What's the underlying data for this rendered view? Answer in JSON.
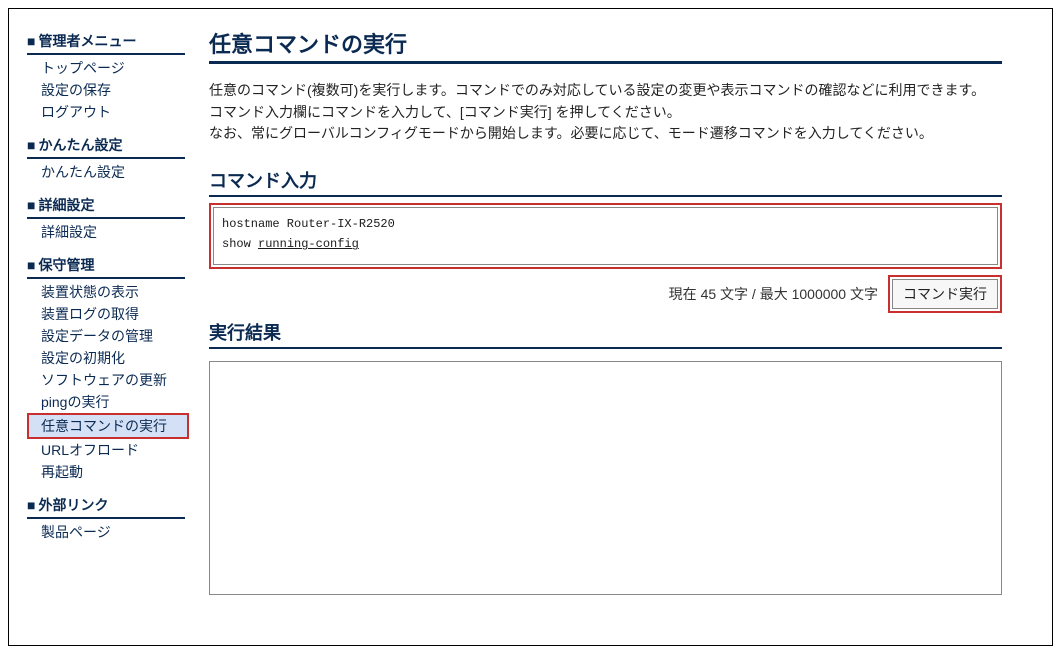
{
  "sidebar": {
    "sections": [
      {
        "title": "管理者メニュー",
        "items": [
          {
            "label": "トップページ",
            "active": false
          },
          {
            "label": "設定の保存",
            "active": false
          },
          {
            "label": "ログアウト",
            "active": false
          }
        ]
      },
      {
        "title": "かんたん設定",
        "items": [
          {
            "label": "かんたん設定",
            "active": false
          }
        ]
      },
      {
        "title": "詳細設定",
        "items": [
          {
            "label": "詳細設定",
            "active": false
          }
        ]
      },
      {
        "title": "保守管理",
        "items": [
          {
            "label": "装置状態の表示",
            "active": false
          },
          {
            "label": "装置ログの取得",
            "active": false
          },
          {
            "label": "設定データの管理",
            "active": false
          },
          {
            "label": "設定の初期化",
            "active": false
          },
          {
            "label": "ソフトウェアの更新",
            "active": false
          },
          {
            "label": "pingの実行",
            "active": false
          },
          {
            "label": "任意コマンドの実行",
            "active": true
          },
          {
            "label": "URLオフロード",
            "active": false
          },
          {
            "label": "再起動",
            "active": false
          }
        ]
      },
      {
        "title": "外部リンク",
        "items": [
          {
            "label": "製品ページ",
            "active": false
          }
        ]
      }
    ]
  },
  "main": {
    "title": "任意コマンドの実行",
    "desc_line1": "任意のコマンド(複数可)を実行します。コマンドでのみ対応している設定の変更や表示コマンドの確認などに利用できます。",
    "desc_line2": "コマンド入力欄にコマンドを入力して、[コマンド実行] を押してください。",
    "desc_line3": "なお、常にグローバルコンフィグモードから開始します。必要に応じて、モード遷移コマンドを入力してください。",
    "input_label": "コマンド入力",
    "command_line1": "hostname Router-IX-R2520",
    "command_line2_prefix": "show ",
    "command_line2_underlined": "running-config",
    "counter_prefix": "現在 ",
    "counter_current": "45",
    "counter_mid": " 文字 / 最大 ",
    "counter_max": "1000000",
    "counter_suffix": " 文字",
    "exec_button": "コマンド実行",
    "result_label": "実行結果",
    "result_value": ""
  }
}
